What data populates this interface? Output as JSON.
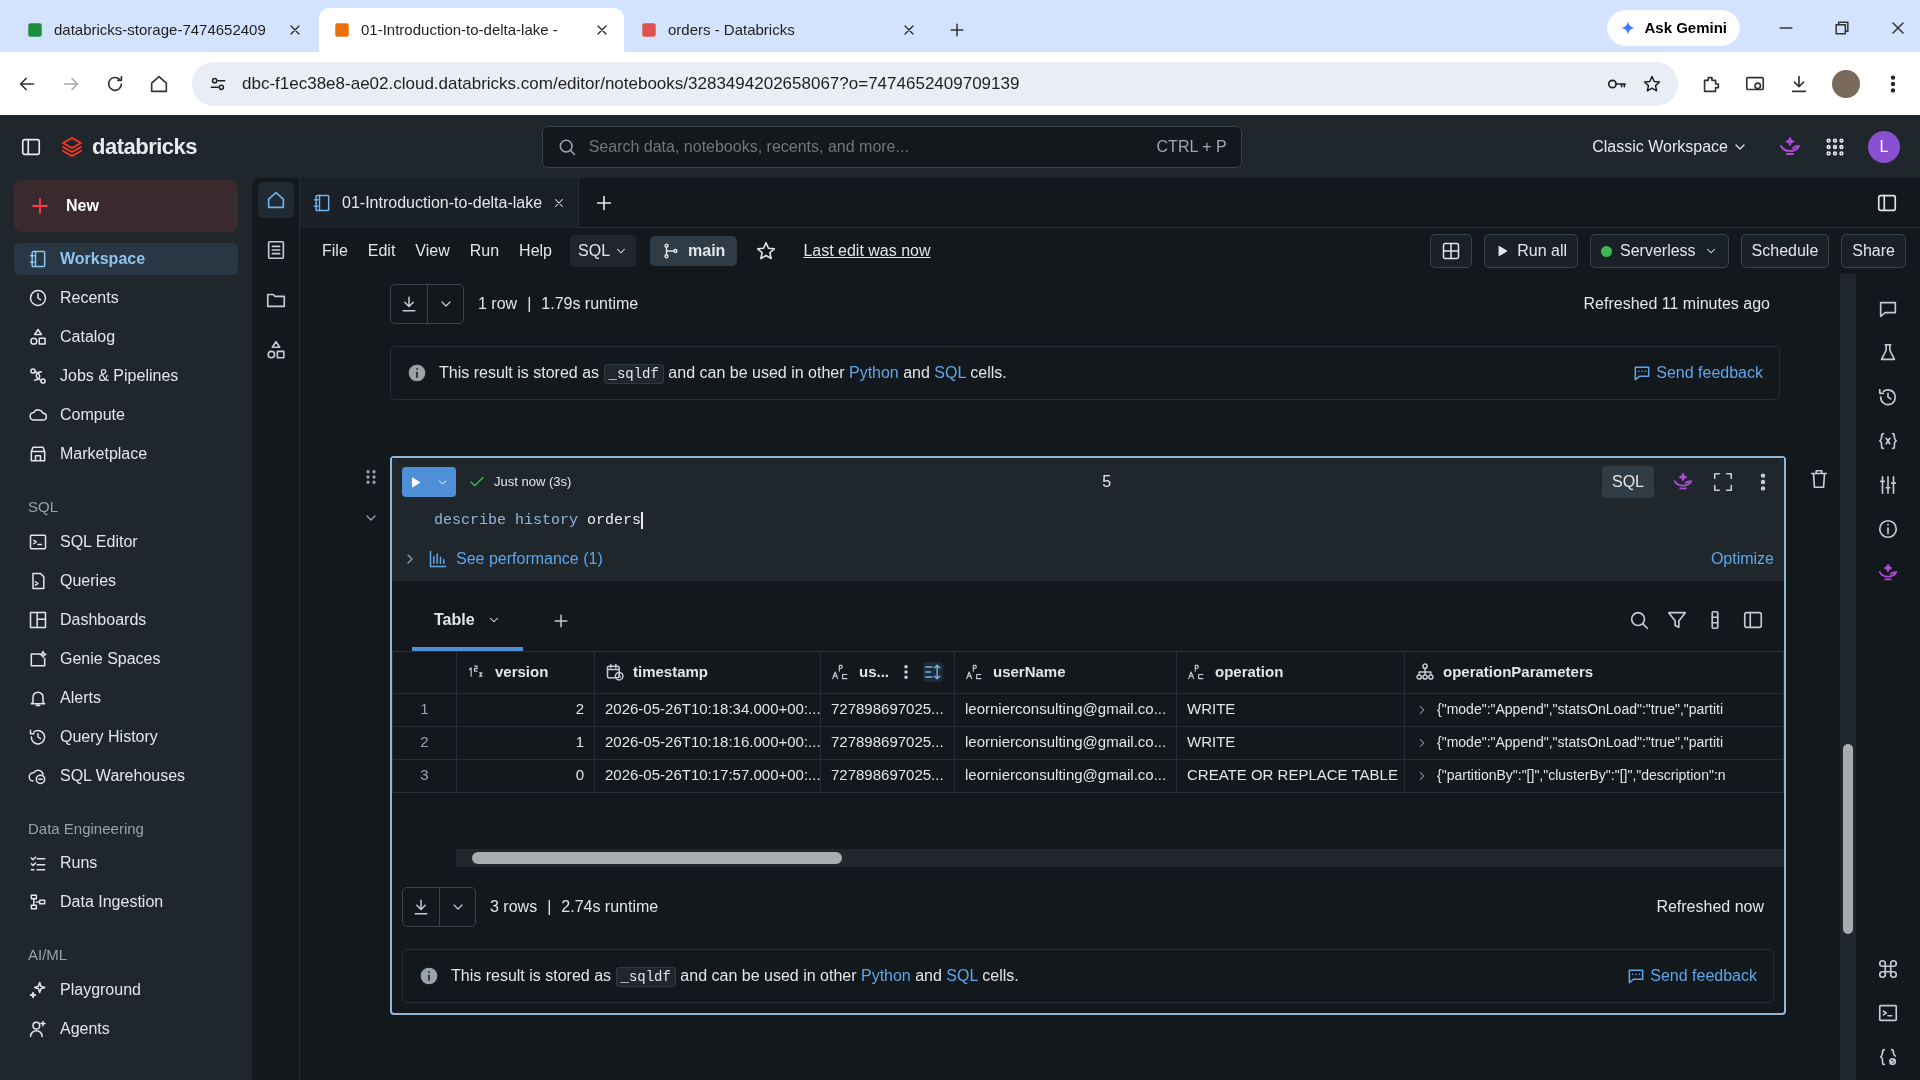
{
  "browser": {
    "tabs": [
      {
        "title": "databricks-storage-7474652409",
        "selected": false
      },
      {
        "title": "01-Introduction-to-delta-lake -",
        "selected": true
      },
      {
        "title": "orders - Databricks",
        "selected": false
      }
    ],
    "gemini": "Ask Gemini",
    "url": "dbc-f1ec38e8-ae02.cloud.databricks.com/editor/notebooks/3283494202658067?o=7474652409709139"
  },
  "topbar": {
    "logo": "databricks",
    "search_placeholder": "Search data, notebooks, recents, and more...",
    "shortcut": "CTRL + P",
    "workspace": "Classic Workspace",
    "user_initial": "L"
  },
  "sidebar": {
    "new": "New",
    "sections": [
      {
        "items": [
          {
            "label": "Workspace",
            "selected": true
          },
          {
            "label": "Recents",
            "selected": false
          },
          {
            "label": "Catalog",
            "selected": false
          },
          {
            "label": "Jobs & Pipelines",
            "selected": false
          },
          {
            "label": "Compute",
            "selected": false
          },
          {
            "label": "Marketplace",
            "selected": false
          }
        ]
      },
      {
        "heading": "SQL",
        "items": [
          {
            "label": "SQL Editor",
            "selected": false
          },
          {
            "label": "Queries",
            "selected": false
          },
          {
            "label": "Dashboards",
            "selected": false
          },
          {
            "label": "Genie Spaces",
            "selected": false
          },
          {
            "label": "Alerts",
            "selected": false
          },
          {
            "label": "Query History",
            "selected": false
          },
          {
            "label": "SQL Warehouses",
            "selected": false
          }
        ]
      },
      {
        "heading": "Data Engineering",
        "items": [
          {
            "label": "Runs",
            "selected": false
          },
          {
            "label": "Data Ingestion",
            "selected": false
          }
        ]
      },
      {
        "heading": "AI/ML",
        "items": [
          {
            "label": "Playground",
            "selected": false
          },
          {
            "label": "Agents",
            "selected": false
          }
        ]
      }
    ]
  },
  "notebook": {
    "tab": "01-Introduction-to-delta-lake",
    "menu": [
      "File",
      "Edit",
      "View",
      "Run",
      "Help"
    ],
    "language": "SQL",
    "branch": "main",
    "last_edit": "Last edit was now",
    "run_all": "Run all",
    "compute": "Serverless",
    "schedule": "Schedule",
    "share": "Share"
  },
  "previous_result": {
    "rows": "1 row",
    "separator": "|",
    "runtime": "1.79s runtime",
    "refreshed": "Refreshed 11 minutes ago",
    "info": [
      {
        "kind": "text",
        "text": "This result is stored as "
      },
      {
        "kind": "code",
        "text": "_sqldf"
      },
      {
        "kind": "text",
        "text": " and can be used in other "
      },
      {
        "kind": "link",
        "text": "Python"
      },
      {
        "kind": "text",
        "text": " and "
      },
      {
        "kind": "link",
        "text": "SQL"
      },
      {
        "kind": "text",
        "text": " cells."
      }
    ],
    "feedback": "Send feedback"
  },
  "cell": {
    "status": "Just now (3s)",
    "number": "5",
    "language": "SQL",
    "code": [
      {
        "kind": "keyword",
        "text": "describe"
      },
      {
        "kind": "keyword",
        "text": "history"
      },
      {
        "kind": "name",
        "text": "orders"
      }
    ],
    "performance": "See performance (1)",
    "optimize": "Optimize",
    "result_tab": "Table",
    "columns": [
      {
        "name": "version",
        "kind": "number"
      },
      {
        "name": "timestamp",
        "kind": "date"
      },
      {
        "name": "us...",
        "kind": "string"
      },
      {
        "name": "userName",
        "kind": "string"
      },
      {
        "name": "operation",
        "kind": "string"
      },
      {
        "name": "operationParameters",
        "kind": "struct"
      }
    ],
    "rows": [
      {
        "index": "1",
        "cells": [
          "2",
          "2026-05-26T10:18:34.000+00:...",
          "727898697025...",
          "leornierconsulting@gmail.co...",
          "WRITE",
          "{\"mode\":\"Append\",\"statsOnLoad\":\"true\",\"partiti"
        ]
      },
      {
        "index": "2",
        "cells": [
          "1",
          "2026-05-26T10:18:16.000+00:...",
          "727898697025...",
          "leornierconsulting@gmail.co...",
          "WRITE",
          "{\"mode\":\"Append\",\"statsOnLoad\":\"true\",\"partiti"
        ]
      },
      {
        "index": "3",
        "cells": [
          "0",
          "2026-05-26T10:17:57.000+00:...",
          "727898697025...",
          "leornierconsulting@gmail.co...",
          "CREATE OR REPLACE TABLE",
          "{\"partitionBy\":\"[]\",\"clusterBy\":\"[]\",\"description\":n"
        ]
      }
    ],
    "result_rows": "3 rows",
    "separator": "|",
    "runtime": "2.74s runtime",
    "refreshed": "Refreshed now",
    "info": [
      {
        "kind": "text",
        "text": "This result is stored as "
      },
      {
        "kind": "code",
        "text": "_sqldf"
      },
      {
        "kind": "text",
        "text": " and can be used in other "
      },
      {
        "kind": "link",
        "text": "Python"
      },
      {
        "kind": "text",
        "text": " and "
      },
      {
        "kind": "link",
        "text": "SQL"
      },
      {
        "kind": "text",
        "text": " cells."
      }
    ],
    "feedback": "Send feedback"
  }
}
